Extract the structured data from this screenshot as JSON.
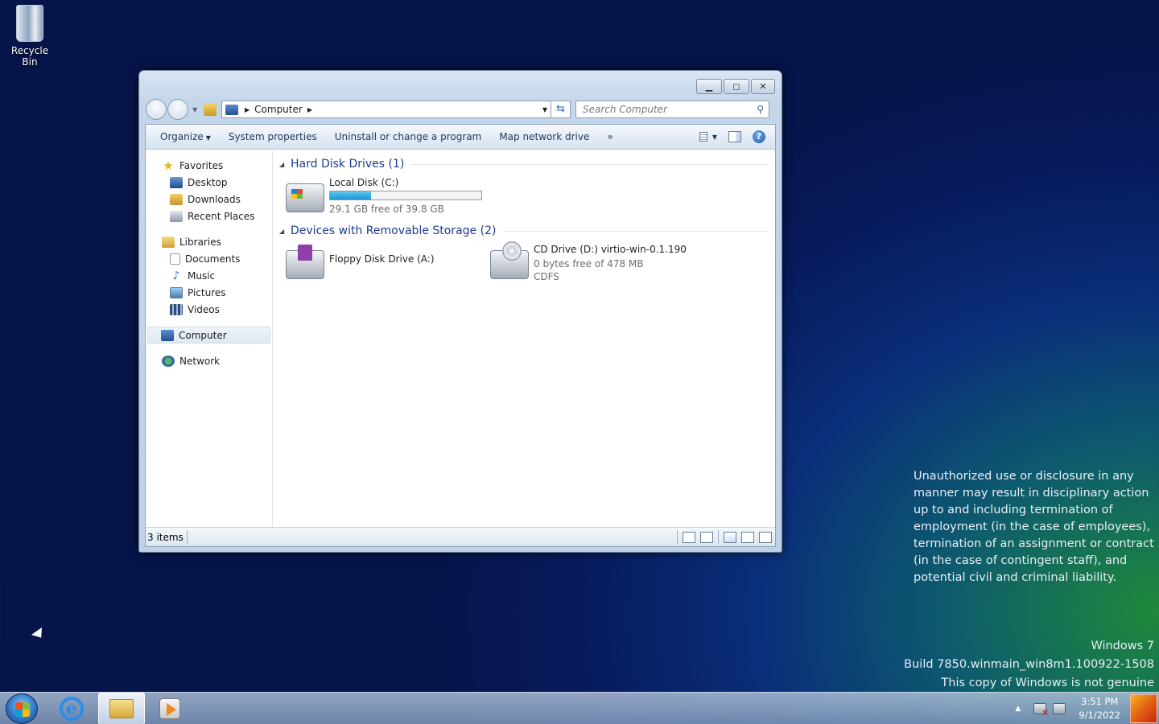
{
  "desktop": {
    "icon_label": "Recycle Bin",
    "legal_text": "Unauthorized use or disclosure in any manner may result in disciplinary action up to and including termination of employment (in the case of employees), termination of an assignment or contract (in the case of contingent staff), and potential civil and criminal liability.",
    "watermark": {
      "line1": "Windows 7",
      "line2": "Build 7850.winmain_win8m1.100922-1508",
      "line3": "This copy of Windows is not genuine"
    }
  },
  "window": {
    "address": {
      "crumb": "Computer"
    },
    "search": {
      "placeholder": "Search Computer"
    },
    "toolbar": {
      "organize": "Organize",
      "system_properties": "System properties",
      "uninstall": "Uninstall or change a program",
      "map_drive": "Map network drive",
      "more": "»"
    },
    "navpane": {
      "favorites": "Favorites",
      "desktop": "Desktop",
      "downloads": "Downloads",
      "recent": "Recent Places",
      "libraries": "Libraries",
      "documents": "Documents",
      "music": "Music",
      "pictures": "Pictures",
      "videos": "Videos",
      "computer": "Computer",
      "network": "Network"
    },
    "groups": {
      "hdd_title": "Hard Disk Drives (1)",
      "removable_title": "Devices with Removable Storage (2)"
    },
    "drives": {
      "c": {
        "name": "Local Disk (C:)",
        "free": "29.1 GB free of 39.8 GB",
        "used_fraction": 0.27
      },
      "a": {
        "name": "Floppy Disk Drive (A:)"
      },
      "d": {
        "name": "CD Drive (D:) virtio-win-0.1.190",
        "free": "0 bytes free of 478 MB",
        "fs": "CDFS"
      }
    },
    "status": {
      "count": "3 items"
    }
  },
  "taskbar": {
    "time": "3:51 PM",
    "date": "9/1/2022"
  },
  "colors": {
    "group_heading": "#1e3c8c",
    "drive_bar_fill": "#1a97cf"
  }
}
